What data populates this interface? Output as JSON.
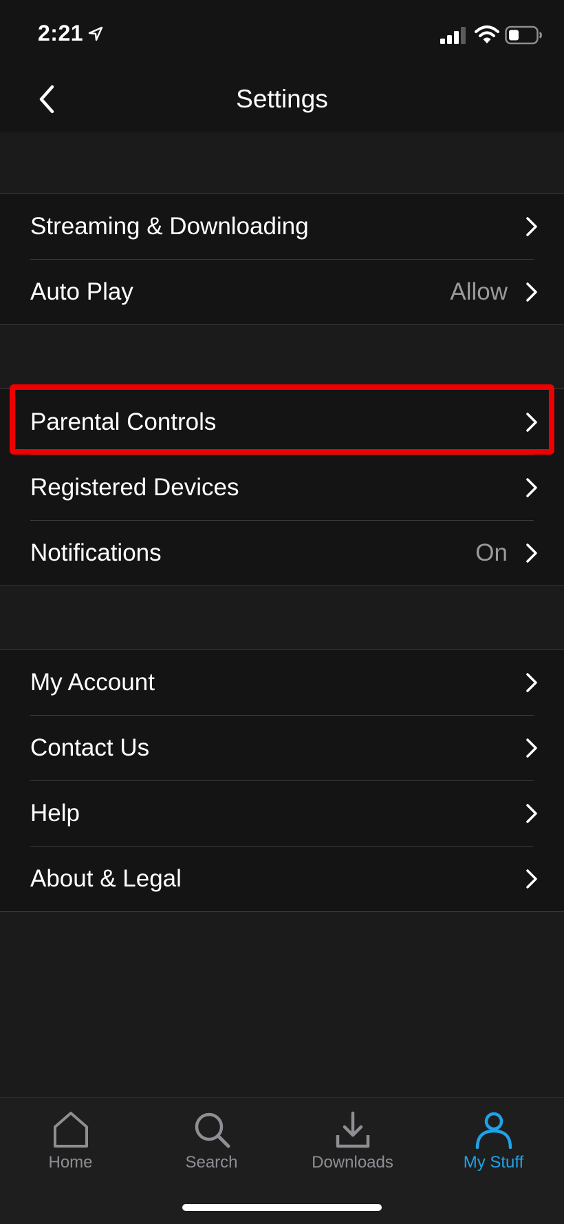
{
  "status_bar": {
    "time": "2:21",
    "icons": [
      "location-icon",
      "signal-icon",
      "wifi-icon",
      "battery-icon"
    ]
  },
  "nav": {
    "title": "Settings",
    "back_icon": "chevron-left-icon"
  },
  "sections": [
    {
      "rows": [
        {
          "label": "Streaming & Downloading",
          "value": ""
        },
        {
          "label": "Auto Play",
          "value": "Allow"
        }
      ]
    },
    {
      "rows": [
        {
          "label": "Parental Controls",
          "value": ""
        },
        {
          "label": "Registered Devices",
          "value": ""
        },
        {
          "label": "Notifications",
          "value": "On"
        }
      ]
    },
    {
      "rows": [
        {
          "label": "My Account",
          "value": ""
        },
        {
          "label": "Contact Us",
          "value": ""
        },
        {
          "label": "Help",
          "value": ""
        },
        {
          "label": "About & Legal",
          "value": ""
        }
      ]
    }
  ],
  "highlighted_row": "Parental Controls",
  "tabs": [
    {
      "label": "Home",
      "icon": "home-icon",
      "active": false
    },
    {
      "label": "Search",
      "icon": "search-icon",
      "active": false
    },
    {
      "label": "Downloads",
      "icon": "download-icon",
      "active": false
    },
    {
      "label": "My Stuff",
      "icon": "person-icon",
      "active": true
    }
  ],
  "colors": {
    "background": "#1b1b1c",
    "section_background": "#141414",
    "highlight": "#ee0000",
    "active_tab": "#1fa3e8",
    "inactive_tab": "#8e8e93",
    "secondary_text": "#9a9a9e"
  }
}
